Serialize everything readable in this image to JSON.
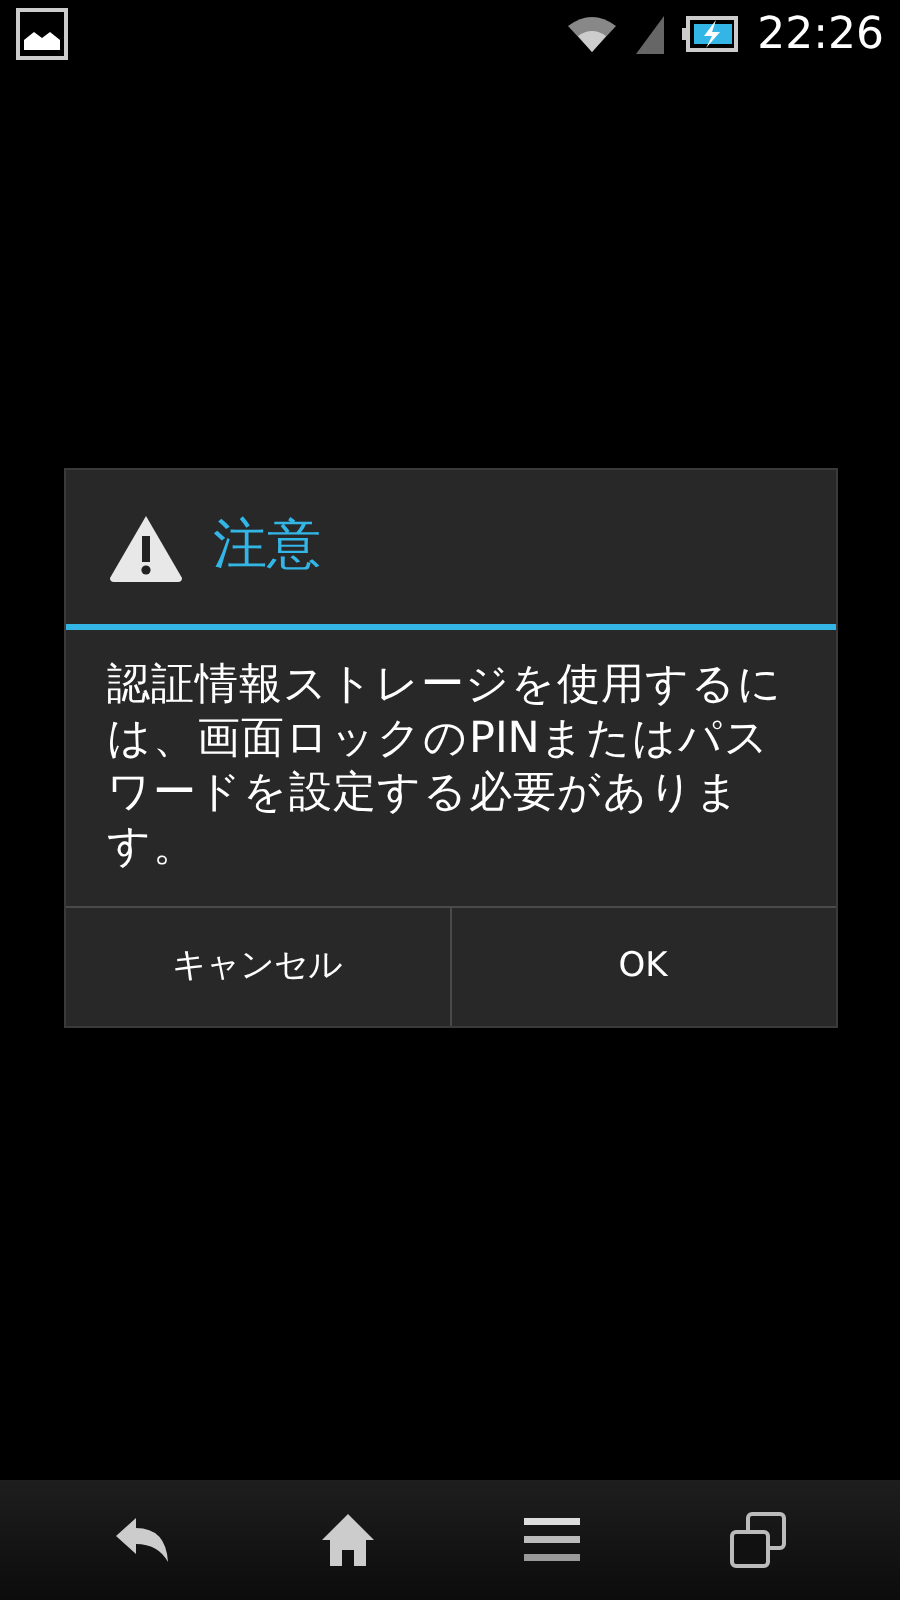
{
  "status_bar": {
    "time": "22:26"
  },
  "dialog": {
    "title": "注意",
    "message": "認証情報ストレージを使用するには、画面ロックのPINまたはパスワードを設定する必要があります。",
    "buttons": [
      "キャンセル",
      "OK"
    ]
  }
}
